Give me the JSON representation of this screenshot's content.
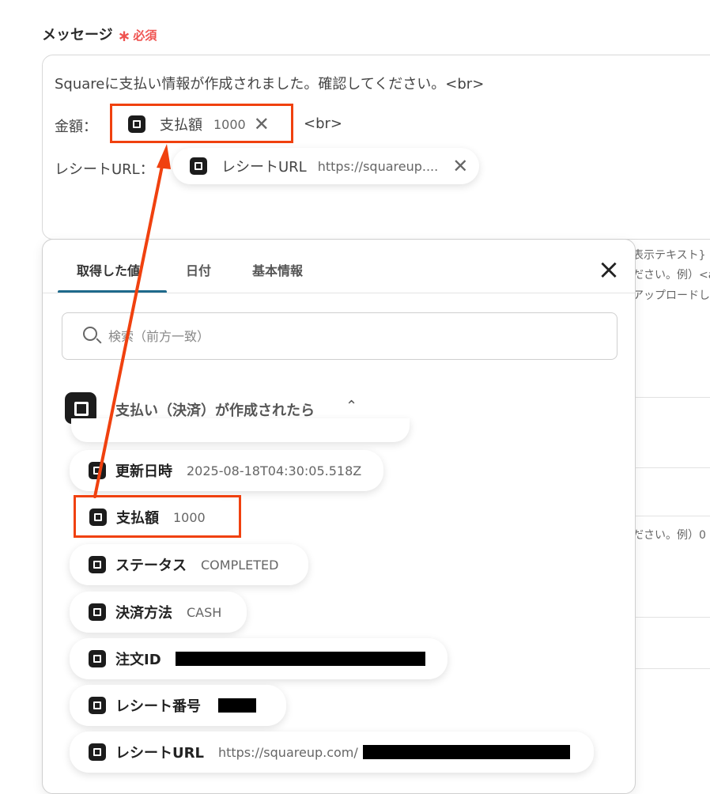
{
  "field": {
    "label": "メッセージ",
    "required": "必須"
  },
  "message": {
    "line1": "Squareに支払い情報が作成されました。確認してください。<br>",
    "line2_prefix": "金額：",
    "line2_suffix": "<br>",
    "line3_prefix": "レシートURL：",
    "chip_amount": {
      "label": "支払額",
      "value": "1000"
    },
    "chip_receipt": {
      "label": "レシートURL",
      "value": "https://squareup...."
    }
  },
  "background_text": {
    "line1": "表示テキスト}",
    "line2": "ださい。例）<a",
    "line3": "アップロードし",
    "line4": "ださい。例）0"
  },
  "picker": {
    "tabs": [
      "取得した値",
      "日付",
      "基本情報"
    ],
    "active_tab": "取得した値",
    "search_placeholder": "検索（前方一致）",
    "section_title": "支払い（決済）が作成されたら",
    "items": [
      {
        "label": "更新日時",
        "value": "2025-08-18T04:30:05.518Z"
      },
      {
        "label": "支払額",
        "value": "1000"
      },
      {
        "label": "ステータス",
        "value": "COMPLETED"
      },
      {
        "label": "決済方法",
        "value": "CASH"
      },
      {
        "label": "注文ID",
        "value": ""
      },
      {
        "label": "レシート番号",
        "value": ""
      },
      {
        "label": "レシートURL",
        "value": "https://squareup.com/"
      }
    ]
  },
  "colors": {
    "accent": "#1f6a8c",
    "highlight": "#f0410f",
    "required": "#ef5350"
  },
  "icons": [
    "square-logo-icon",
    "close-icon",
    "search-icon",
    "chevron-up-icon"
  ]
}
